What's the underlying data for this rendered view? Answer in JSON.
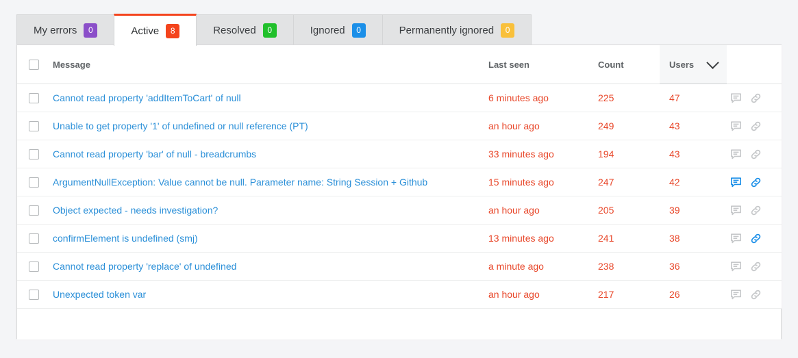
{
  "tabs": [
    {
      "label": "My errors",
      "count": "0",
      "badge_color": "#8b4fc9",
      "active": false
    },
    {
      "label": "Active",
      "count": "8",
      "badge_color": "#f4441d",
      "active": true
    },
    {
      "label": "Resolved",
      "count": "0",
      "badge_color": "#21c02b",
      "active": false
    },
    {
      "label": "Ignored",
      "count": "0",
      "badge_color": "#1b8fe8",
      "active": false
    },
    {
      "label": "Permanently ignored",
      "count": "0",
      "badge_color": "#f9c03a",
      "active": false
    }
  ],
  "table": {
    "columns": {
      "message": "Message",
      "last_seen": "Last seen",
      "count": "Count",
      "users": "Users"
    },
    "sort_column": "Users",
    "sort_icon": "chevron-down-icon",
    "select_all_checked": false,
    "rows": [
      {
        "message": "Cannot read property 'addItemToCart' of null",
        "last_seen": "6 minutes ago",
        "count": "225",
        "users": "47",
        "comment_active": false,
        "link_active": false,
        "checked": false
      },
      {
        "message": "Unable to get property '1' of undefined or null reference (PT)",
        "last_seen": "an hour ago",
        "count": "249",
        "users": "43",
        "comment_active": false,
        "link_active": false,
        "checked": false
      },
      {
        "message": "Cannot read property 'bar' of null - breadcrumbs",
        "last_seen": "33 minutes ago",
        "count": "194",
        "users": "43",
        "comment_active": false,
        "link_active": false,
        "checked": false
      },
      {
        "message": "ArgumentNullException: Value cannot be null. Parameter name: String Session + Github",
        "last_seen": "15 minutes ago",
        "count": "247",
        "users": "42",
        "comment_active": true,
        "link_active": true,
        "checked": false
      },
      {
        "message": "Object expected - needs investigation?",
        "last_seen": "an hour ago",
        "count": "205",
        "users": "39",
        "comment_active": false,
        "link_active": false,
        "checked": false
      },
      {
        "message": "confirmElement is undefined (smj)",
        "last_seen": "13 minutes ago",
        "count": "241",
        "users": "38",
        "comment_active": false,
        "link_active": true,
        "checked": false
      },
      {
        "message": "Cannot read property 'replace' of undefined",
        "last_seen": "a minute ago",
        "count": "238",
        "users": "36",
        "comment_active": false,
        "link_active": false,
        "checked": false
      },
      {
        "message": "Unexpected token var",
        "last_seen": "an hour ago",
        "count": "217",
        "users": "26",
        "comment_active": false,
        "link_active": false,
        "checked": false
      }
    ]
  },
  "colors": {
    "page_background": "#f4f5f7",
    "active_tab_accent": "#f4441d",
    "link": "#2a8fd8",
    "value_text": "#e8472a",
    "icon_inactive": "#c6c8ca",
    "icon_active": "#1b8fe8"
  }
}
